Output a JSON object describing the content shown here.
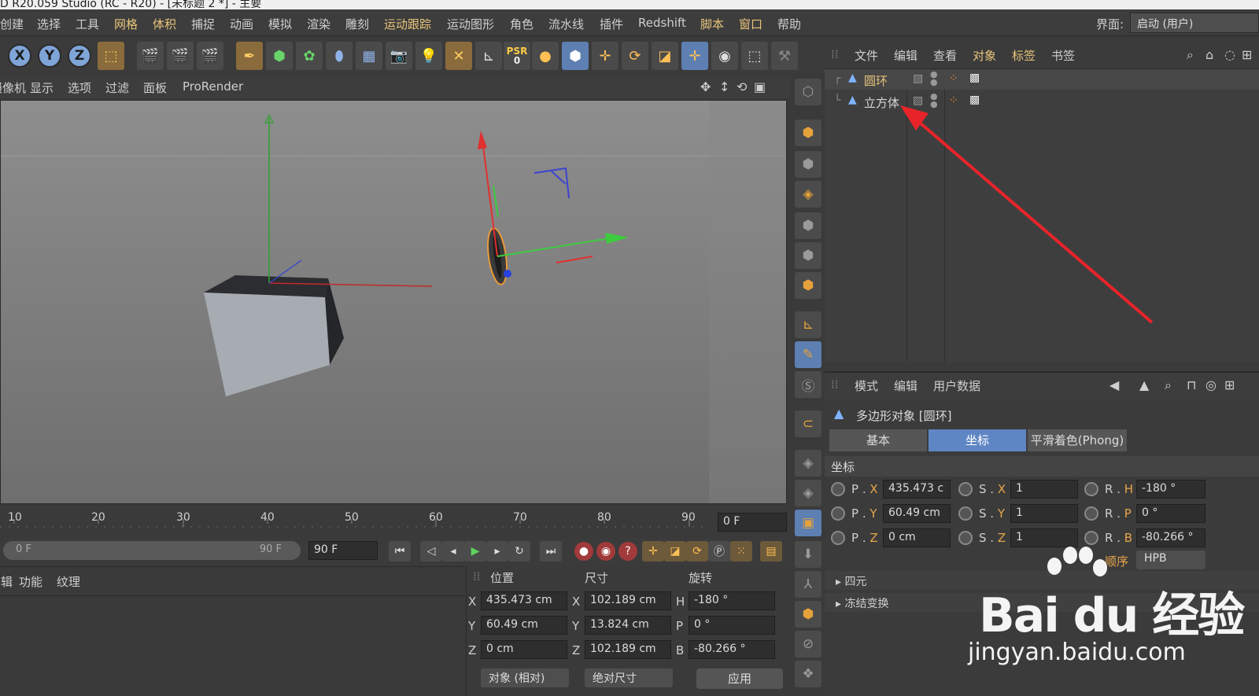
{
  "titlebar": {
    "text": "D R20.059 Studio (RC - R20) - [未标题 2 *] - 主要"
  },
  "menubar": {
    "items": [
      "创建",
      "选择",
      "工具",
      "网格",
      "体积",
      "捕捉",
      "动画",
      "模拟",
      "渲染",
      "雕刻",
      "运动跟踪",
      "运动图形",
      "角色",
      "流水线",
      "插件",
      "Redshift",
      "脚本",
      "窗口",
      "帮助"
    ],
    "ui_label": "界面:",
    "layout_value": "启动 (用户)"
  },
  "toolbar": {
    "axis_x": "X",
    "axis_y": "Y",
    "axis_z": "Z",
    "psr_top": "PSR",
    "psr_bottom": "0"
  },
  "viewport": {
    "menu": [
      "摄像机",
      "显示",
      "选项",
      "过滤",
      "面板",
      "ProRender"
    ]
  },
  "timeline": {
    "ticks": [
      "10",
      "20",
      "30",
      "40",
      "50",
      "60",
      "70",
      "80",
      "90"
    ],
    "current_frame": "0 F",
    "range_start": "0 F",
    "range_end": "90 F",
    "end_frame": "90 F"
  },
  "bottom_left": {
    "tabs": [
      "编辑",
      "功能",
      "纹理"
    ]
  },
  "coords": {
    "head_position": "位置",
    "head_size": "尺寸",
    "head_rotation": "旋转",
    "rows": [
      {
        "axis": "X",
        "pos": "435.473 cm",
        "size_axis": "X",
        "size": "102.189 cm",
        "rot_axis": "H",
        "rot": "-180 °"
      },
      {
        "axis": "Y",
        "pos": "60.49 cm",
        "size_axis": "Y",
        "size": "13.824 cm",
        "rot_axis": "P",
        "rot": "0 °"
      },
      {
        "axis": "Z",
        "pos": "0 cm",
        "size_axis": "Z",
        "size": "102.189 cm",
        "rot_axis": "B",
        "rot": "-80.266 °"
      }
    ],
    "mode_dropdown": "对象 (相对)",
    "size_dropdown": "绝对尺寸",
    "apply": "应用"
  },
  "object_manager": {
    "menu": [
      "文件",
      "编辑",
      "查看",
      "对象",
      "标签",
      "书签"
    ],
    "objects": [
      {
        "name": "圆环",
        "selected": true
      },
      {
        "name": "立方体",
        "selected": false
      }
    ]
  },
  "attribute_manager": {
    "menu": [
      "模式",
      "编辑",
      "用户数据"
    ],
    "title": "多边形对象 [圆环]",
    "tabs": [
      "基本",
      "坐标",
      "平滑着色(Phong)"
    ],
    "active_tab": "坐标",
    "section": "坐标",
    "rows": [
      {
        "p_lbl": "P . ",
        "p_ax": "X",
        "p": "435.473 c",
        "s_lbl": "S . ",
        "s_ax": "X",
        "s": "1",
        "r_lbl": "R . ",
        "r_ax": "H",
        "r": "-180 °"
      },
      {
        "p_lbl": "P . ",
        "p_ax": "Y",
        "p": "60.49 cm",
        "s_lbl": "S . ",
        "s_ax": "Y",
        "s": "1",
        "r_lbl": "R . ",
        "r_ax": "P",
        "r": "0 °"
      },
      {
        "p_lbl": "P . ",
        "p_ax": "Z",
        "p": "0 cm",
        "s_lbl": "S . ",
        "s_ax": "Z",
        "s": "1",
        "r_lbl": "R . ",
        "r_ax": "B",
        "r": "-80.266 °"
      }
    ],
    "order_label": "顺序",
    "order_value": "HPB",
    "quaternion": "四元",
    "freeze": "冻结变换"
  },
  "watermark": {
    "brand": "Bai du 经验",
    "url": "jingyan.baidu.com"
  },
  "colors": {
    "accent_orange": "#e8c47a",
    "active_tab": "#5f86c4",
    "arrow": "#e8242a"
  }
}
